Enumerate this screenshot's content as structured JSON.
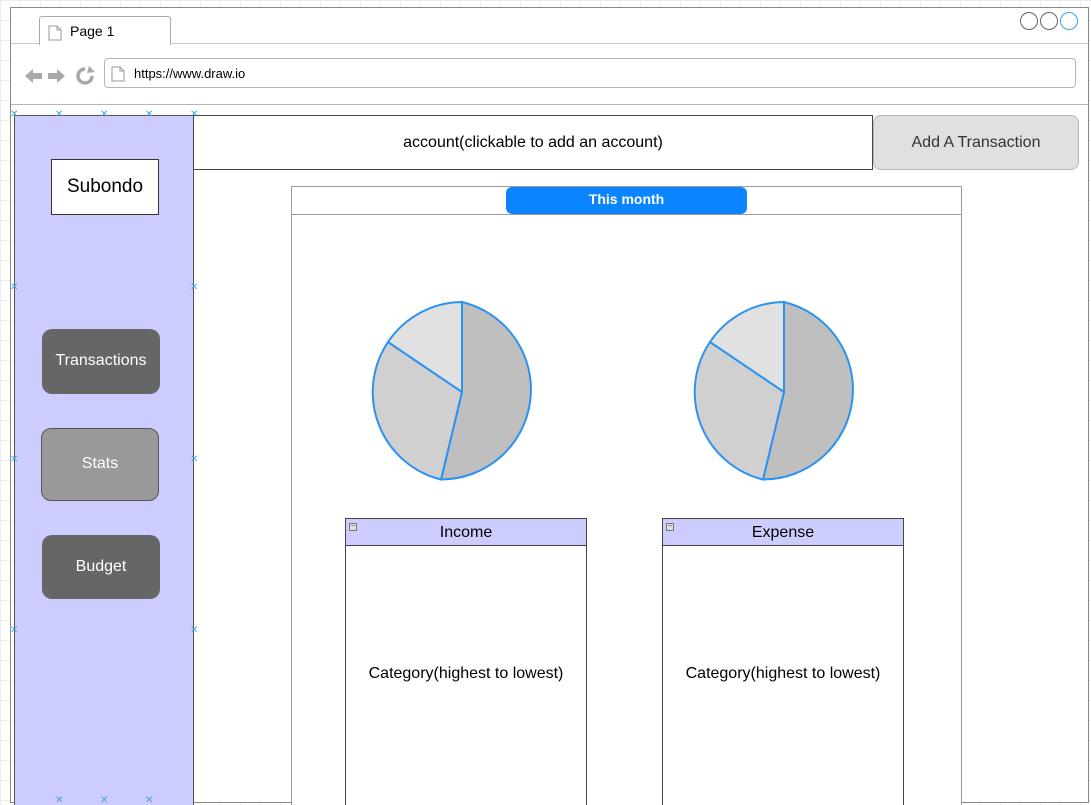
{
  "browser": {
    "tab_label": "Page 1",
    "url": "https://www.draw.io"
  },
  "sidebar": {
    "logo": "Subondo",
    "items": [
      {
        "label": "Transactions"
      },
      {
        "label": "Stats"
      },
      {
        "label": "Budget"
      }
    ]
  },
  "header": {
    "account_label": "account(clickable to add an account)",
    "add_transaction_label": "Add A Transaction"
  },
  "main": {
    "period_label": "This month",
    "income": {
      "title": "Income",
      "body": "Category(highest to lowest)"
    },
    "expense": {
      "title": "Expense",
      "body": "Category(highest to lowest)"
    }
  },
  "colors": {
    "sidebar_bg": "#ccccff",
    "accent_blue": "#0a84ff",
    "nav_button_dark": "#666666",
    "nav_button_selected": "#999999",
    "pie_stroke": "#2a93f0"
  },
  "icons": [
    "page-icon",
    "back-arrow-icon",
    "forward-arrow-icon",
    "reload-icon"
  ]
}
